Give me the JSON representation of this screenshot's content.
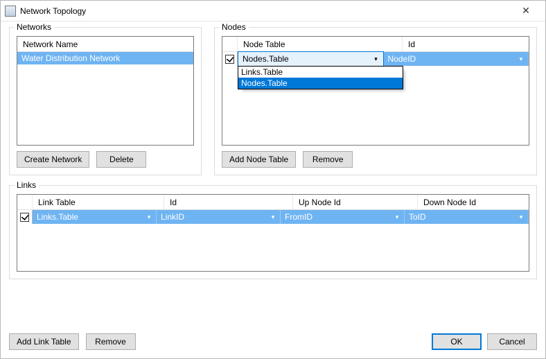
{
  "window": {
    "title": "Network Topology"
  },
  "networks": {
    "group_label": "Networks",
    "header": "Network Name",
    "items": [
      "Water Distribution Network"
    ],
    "create_btn": "Create Network",
    "delete_btn": "Delete"
  },
  "nodes": {
    "group_label": "Nodes",
    "headers": {
      "table": "Node Table",
      "id": "Id"
    },
    "row": {
      "checked": true,
      "table_value": "Nodes.Table",
      "id_value": "NodeID"
    },
    "dropdown_options": [
      "Links.Table",
      "Nodes.Table"
    ],
    "dropdown_selected": "Nodes.Table",
    "add_btn": "Add Node Table",
    "remove_btn": "Remove"
  },
  "links": {
    "group_label": "Links",
    "headers": {
      "table": "Link Table",
      "id": "Id",
      "up": "Up Node Id",
      "down": "Down Node Id"
    },
    "row": {
      "checked": true,
      "table_value": "Links.Table",
      "id_value": "LinkID",
      "up_value": "FromID",
      "down_value": "ToID"
    },
    "add_btn": "Add Link Table",
    "remove_btn": "Remove"
  },
  "buttons": {
    "ok": "OK",
    "cancel": "Cancel"
  }
}
